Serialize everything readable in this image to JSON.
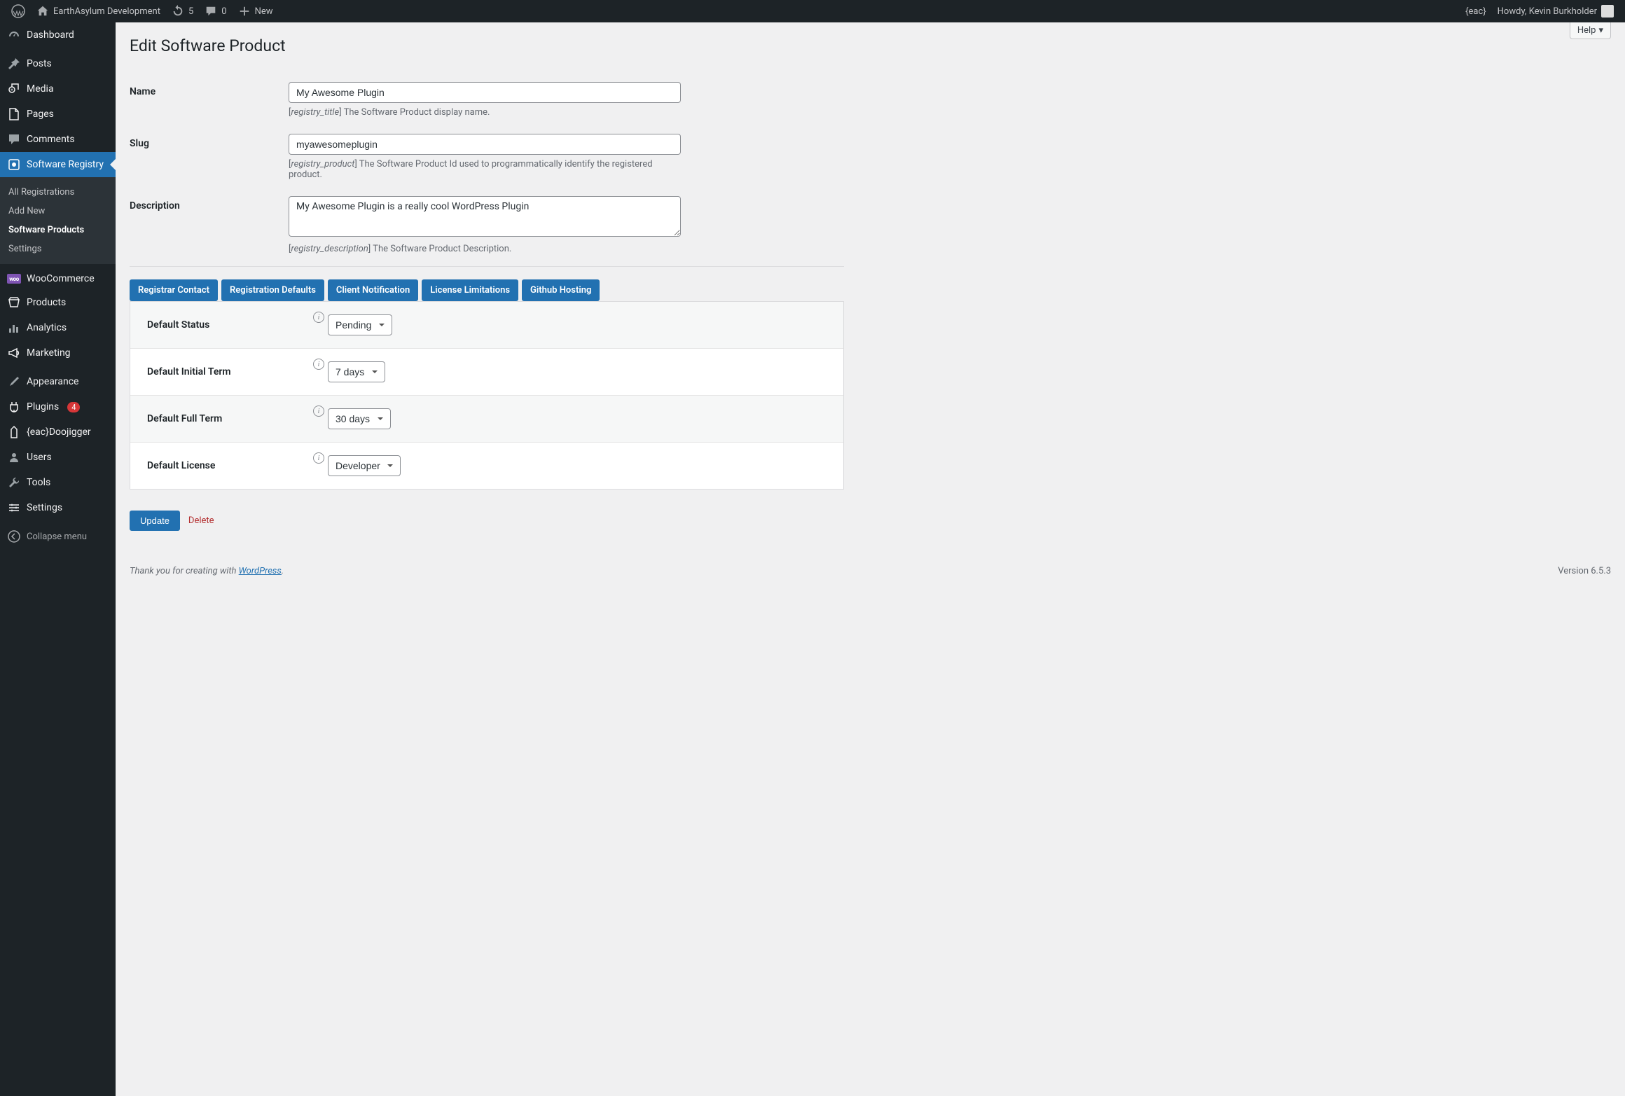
{
  "adminbar": {
    "site_name": "EarthAsylum Development",
    "updates": "5",
    "comments": "0",
    "new_label": "New",
    "eac_label": "{eac}",
    "greeting": "Howdy, Kevin Burkholder"
  },
  "sidebar": {
    "dashboard": "Dashboard",
    "posts": "Posts",
    "media": "Media",
    "pages": "Pages",
    "comments": "Comments",
    "software_registry": "Software Registry",
    "submenu": {
      "all_registrations": "All Registrations",
      "add_new": "Add New",
      "software_products": "Software Products",
      "settings": "Settings"
    },
    "woocommerce": "WooCommerce",
    "products": "Products",
    "analytics": "Analytics",
    "marketing": "Marketing",
    "appearance": "Appearance",
    "plugins": "Plugins",
    "plugins_count": "4",
    "doojigger": "{eac}Doojigger",
    "users": "Users",
    "tools": "Tools",
    "settings_menu": "Settings",
    "collapse": "Collapse menu"
  },
  "page": {
    "help_label": "Help",
    "title": "Edit Software Product",
    "fields": {
      "name": {
        "label": "Name",
        "value": "My Awesome Plugin",
        "desc_code": "registry_title",
        "desc_text": "] The Software Product display name."
      },
      "slug": {
        "label": "Slug",
        "value": "myawesomeplugin",
        "desc_code": "registry_product",
        "desc_text": "] The Software Product Id used to programmatically identify the registered product."
      },
      "description": {
        "label": "Description",
        "value": "My Awesome Plugin is a really cool WordPress Plugin",
        "desc_code": "registry_description",
        "desc_text": "] The Software Product Description."
      }
    },
    "tabs": {
      "registrar_contact": "Registrar Contact",
      "registration_defaults": "Registration Defaults",
      "client_notification": "Client Notification",
      "license_limitations": "License Limitations",
      "github_hosting": "Github Hosting"
    },
    "panel": {
      "default_status": {
        "label": "Default Status",
        "value": "Pending"
      },
      "default_initial_term": {
        "label": "Default Initial Term",
        "value": "7 days"
      },
      "default_full_term": {
        "label": "Default Full Term",
        "value": "30 days"
      },
      "default_license": {
        "label": "Default License",
        "value": "Developer"
      }
    },
    "actions": {
      "update": "Update",
      "delete": "Delete"
    }
  },
  "footer": {
    "thank_pre": "Thank you for creating with ",
    "wp": "WordPress",
    "thank_post": ".",
    "version": "Version 6.5.3"
  },
  "woo_icon_text": "woo"
}
